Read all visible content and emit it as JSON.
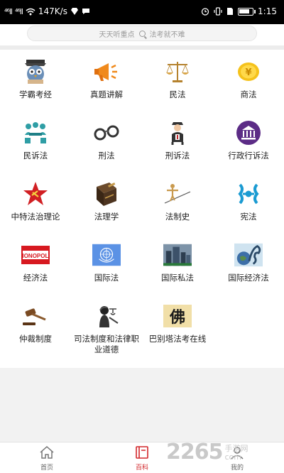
{
  "status": {
    "signal1": "⁴⁶ll",
    "signal2": "⁴⁶ll",
    "wifi": "wifi-icon",
    "speed": "147K/s",
    "time": "1:15",
    "battery_level": 0.85
  },
  "search": {
    "left_text": "天天听重点",
    "right_text": "法考就不难"
  },
  "categories": [
    {
      "label": "学霸考经",
      "icon": "scholar-owl-icon"
    },
    {
      "label": "真题讲解",
      "icon": "megaphone-icon"
    },
    {
      "label": "民法",
      "icon": "scales-icon"
    },
    {
      "label": "商法",
      "icon": "yen-coin-icon"
    },
    {
      "label": "民诉法",
      "icon": "meeting-people-icon"
    },
    {
      "label": "刑法",
      "icon": "handcuffs-icon"
    },
    {
      "label": "刑诉法",
      "icon": "officer-icon"
    },
    {
      "label": "行政行诉法",
      "icon": "government-building-icon"
    },
    {
      "label": "中特法治理论",
      "icon": "red-star-icon"
    },
    {
      "label": "法理学",
      "icon": "law-book-icon"
    },
    {
      "label": "法制史",
      "icon": "tightrope-icon"
    },
    {
      "label": "宪法",
      "icon": "constitution-emblem-icon"
    },
    {
      "label": "经济法",
      "icon": "monopoly-icon"
    },
    {
      "label": "国际法",
      "icon": "un-flag-icon"
    },
    {
      "label": "国际私法",
      "icon": "city-skyline-icon"
    },
    {
      "label": "国际经济法",
      "icon": "globe-dragon-icon"
    },
    {
      "label": "仲裁制度",
      "icon": "gavel-icon"
    },
    {
      "label": "司法制度和法律职业道德",
      "icon": "justice-statue-icon"
    },
    {
      "label": "巴别塔法考在线",
      "icon": "babel-logo-icon"
    }
  ],
  "monopoly_text": "MONOPOLY",
  "babel_char": "佛",
  "tabs": [
    {
      "label": "首页",
      "icon": "home-icon"
    },
    {
      "label": "百科",
      "icon": "book-icon"
    },
    {
      "label": "我的",
      "icon": "profile-icon"
    }
  ],
  "watermark": {
    "number": "2265",
    "suffix_top": "手游网",
    "suffix_bottom": "com"
  },
  "colors": {
    "accent": "#d2262a",
    "text": "#222222",
    "status_bg": "#000000"
  }
}
